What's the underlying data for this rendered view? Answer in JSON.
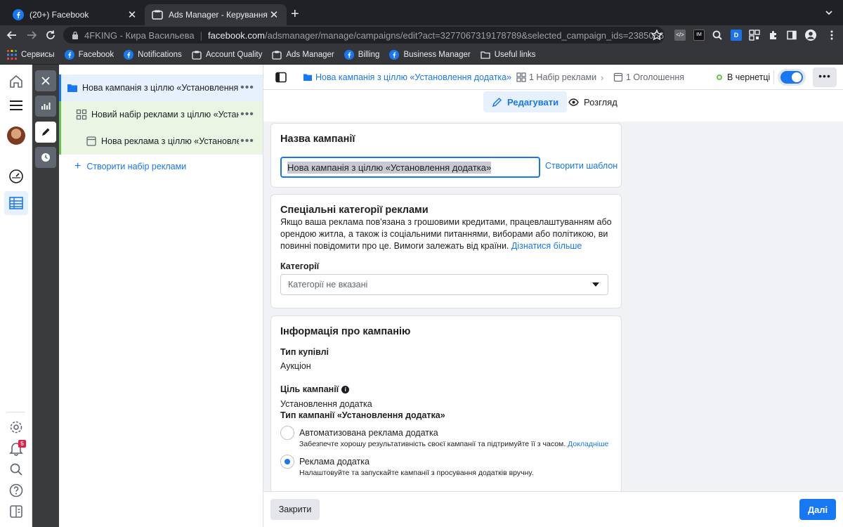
{
  "browser": {
    "tabs": [
      {
        "title": "(20+) Facebook",
        "active": false
      },
      {
        "title": "Ads Manager - Керування рек",
        "active": true
      }
    ],
    "profile": "4FKING - Кира Васильева",
    "url_domain": "facebook.com",
    "url_path": "/adsmanager/manage/campaigns/edit?act=3277067319178789&selected_campaign_ids=23850565...",
    "bookmarks": [
      {
        "label": "Сервисы",
        "icon": "apps-grid-icon"
      },
      {
        "label": "Facebook",
        "icon": "facebook-icon"
      },
      {
        "label": "Notifications",
        "icon": "facebook-icon"
      },
      {
        "label": "Account Quality",
        "icon": "bookmark-page-icon"
      },
      {
        "label": "Ads Manager",
        "icon": "bookmark-page-icon"
      },
      {
        "label": "Billing",
        "icon": "facebook-icon"
      },
      {
        "label": "Business Manager",
        "icon": "facebook-icon"
      },
      {
        "label": "Useful links",
        "icon": "folder-icon"
      }
    ]
  },
  "leftnav": {
    "notifications_count": "5"
  },
  "tree": {
    "campaign": "Нова кампанія з ціллю «Установлення додатка»",
    "adset": "Новий набір реклами з ціллю «Установлення додатка»",
    "ad": "Нова реклама з ціллю «Установлення додатка»",
    "create_adset": "Створити набір реклами"
  },
  "topbar": {
    "crumb_campaign": "Нова кампанія з ціллю «Установлення додатка»",
    "crumb_adsets": "1 Набір реклами",
    "crumb_ads": "1 Оголошення",
    "status": "В чернетці",
    "more": "•••"
  },
  "modes": {
    "edit": "Редагувати",
    "view": "Розгляд"
  },
  "campaign_name": {
    "heading": "Назва кампанії",
    "value": "Нова кампанія з ціллю «Установлення додатка»",
    "template_link": "Створити шаблон"
  },
  "special": {
    "heading": "Спеціальні категорії реклами",
    "description": "Якщо ваша реклама пов'язана з грошовими кредитами, працевлаштуванням або орендою житла, а також із соціальними питаннями, виборами або політикою, ви повинні повідомити про це. Вимоги залежать від країни.",
    "learn_more": "Дізнатися більше",
    "categories_label": "Категорії",
    "categories_value": "Категорії не вказані"
  },
  "info": {
    "heading": "Інформація про кампанію",
    "buying_type_label": "Тип купівлі",
    "buying_type_value": "Аукціон",
    "objective_label": "Ціль кампанії",
    "objective_value": "Установлення додатка",
    "campaign_type_label": "Тип кампанії «Установлення додатка»",
    "options": [
      {
        "title": "Автоматизована реклама додатка",
        "subtitle": "Забезпечте хорошу результативність своєї кампанії та підтримуйте її з часом.",
        "link": "Докладніше",
        "selected": false
      },
      {
        "title": "Реклама додатка",
        "subtitle": "Налаштовуйте та запускайте кампанії з просування додатків вручну.",
        "link": "",
        "selected": true
      }
    ]
  },
  "footer": {
    "close": "Закрити",
    "next": "Далі"
  },
  "colors": {
    "accent": "#1877f2",
    "draft_green": "#6bbf4e",
    "chrome_dark": "#202124"
  }
}
